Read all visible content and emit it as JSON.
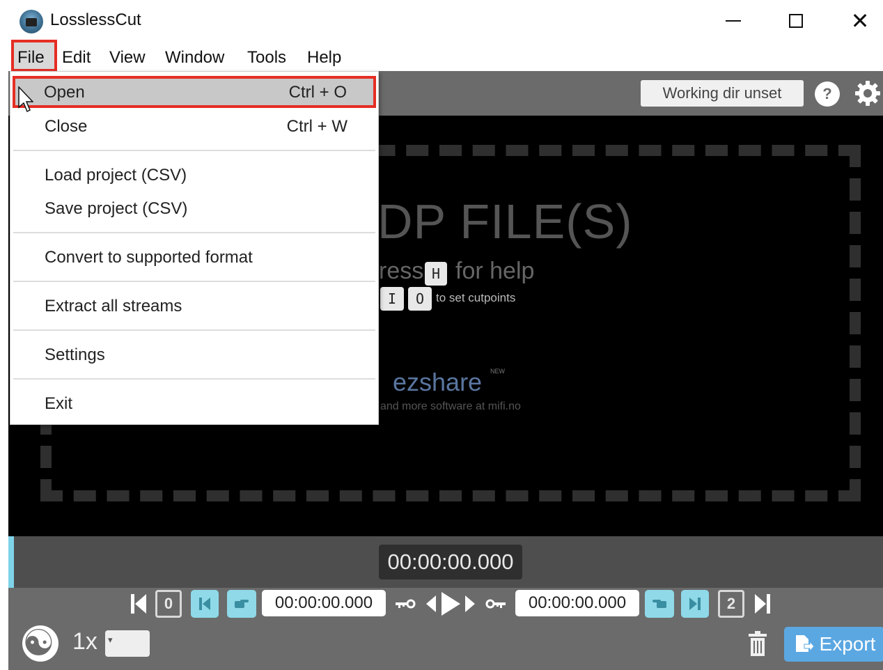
{
  "window": {
    "title": "LosslessCut",
    "minimize_label": "minimize",
    "maximize_label": "maximize",
    "close_glyph": "✕"
  },
  "menubar": {
    "items": [
      "File",
      "Edit",
      "View",
      "Window",
      "Tools",
      "Help"
    ]
  },
  "file_menu": {
    "items": [
      {
        "label": "Open",
        "shortcut": "Ctrl + O"
      },
      {
        "label": "Close",
        "shortcut": "Ctrl + W"
      },
      {
        "label": "Load project (CSV)",
        "shortcut": ""
      },
      {
        "label": "Save project (CSV)",
        "shortcut": ""
      },
      {
        "label": "Convert to supported format",
        "shortcut": ""
      },
      {
        "label": "Extract all streams",
        "shortcut": ""
      },
      {
        "label": "Settings",
        "shortcut": ""
      },
      {
        "label": "Exit",
        "shortcut": ""
      }
    ]
  },
  "topbar": {
    "working_dir_label": "Working dir unset",
    "help_label": "?"
  },
  "player": {
    "drop_text": "DP FILE(S)",
    "press_text": "ress",
    "help_key": "H",
    "for_help": "for help",
    "cut_key_in": "I",
    "cut_key_out": "O",
    "cutpoints_text": "to set cutpoints",
    "brand": "ezshare",
    "brand_badge": "NEW",
    "more_software": "and more software at mifi.no"
  },
  "timeline": {
    "current_time": "00:00:00.000"
  },
  "controls": {
    "start_time": "00:00:00.000",
    "end_time": "00:00:00.000",
    "left_segment_number": "0",
    "right_segment_number": "2",
    "playback_rate": "1x",
    "export_label": "Export"
  },
  "colors": {
    "highlight_red": "#e52e24",
    "teal": "#8fd9e8",
    "export_blue": "#5aa7e2"
  }
}
